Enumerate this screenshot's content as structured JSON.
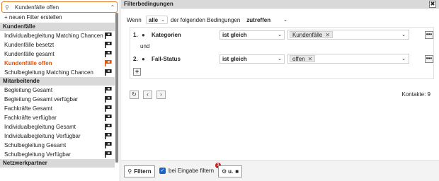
{
  "left": {
    "selector_value": "Kundenfälle offen",
    "new_filter_label": "+ neuen Filter erstellen",
    "groups": [
      {
        "title": "Kundenfälle",
        "items": [
          {
            "label": "Individualbegleitung Matching Chancen",
            "active": false
          },
          {
            "label": "Kundenfälle besetzt",
            "active": false
          },
          {
            "label": "Kundenfälle gesamt",
            "active": false
          },
          {
            "label": "Kundenfälle offen",
            "active": true
          },
          {
            "label": "Schulbegleitung Matching Chancen",
            "active": false
          }
        ]
      },
      {
        "title": "Mitarbeitende",
        "items": [
          {
            "label": "Begleitung Gesamt",
            "active": false
          },
          {
            "label": "Begleitung Gesamt verfügbar",
            "active": false
          },
          {
            "label": "Fachkräfte Gesamt",
            "active": false
          },
          {
            "label": "Fachkräfte verfügbar",
            "active": false
          },
          {
            "label": "Individualbegleitung Gesamt",
            "active": false
          },
          {
            "label": "Individualbegleitung Verfügbar",
            "active": false
          },
          {
            "label": "Schulbegleitung Gesamt",
            "active": false
          },
          {
            "label": "Schulbegleitung Verfügbar",
            "active": false
          }
        ]
      },
      {
        "title": "Netzwerkpartner",
        "items": []
      }
    ]
  },
  "right": {
    "title": "Filterbedingungen",
    "close_label": "✖",
    "cond": {
      "prefix": "Wenn",
      "quantifier": "alle",
      "middle": "der folgenden Bedingungen",
      "verb": "zutreffen"
    },
    "filters": [
      {
        "num": "1.",
        "field": "Kategorien",
        "operator": "ist gleich",
        "value": "Kundenfälle"
      },
      {
        "num": "2.",
        "field": "Fall-Status",
        "operator": "ist gleich",
        "value": "offen"
      }
    ],
    "joiner": "und",
    "more_label": "•••",
    "plus_label": "+",
    "contacts": "Kontakte: 9",
    "bottom": {
      "filter_btn": "Filtern",
      "checkbox_label": "bei Eingabe filtern",
      "gear_btn": "u.",
      "badge": "1"
    }
  },
  "icons": {
    "close": "close-icon",
    "eye": "eye-icon",
    "refresh": "refresh-icon",
    "search": "search-icon",
    "gear": "gear-icon",
    "save": "save-icon"
  }
}
